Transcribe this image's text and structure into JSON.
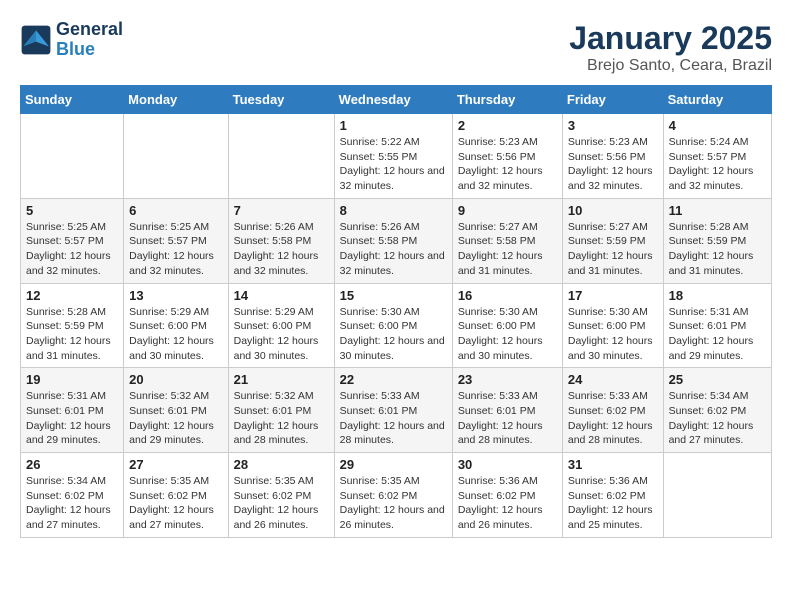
{
  "logo": {
    "line1": "General",
    "line2": "Blue"
  },
  "title": "January 2025",
  "subtitle": "Brejo Santo, Ceara, Brazil",
  "days_of_week": [
    "Sunday",
    "Monday",
    "Tuesday",
    "Wednesday",
    "Thursday",
    "Friday",
    "Saturday"
  ],
  "weeks": [
    [
      {
        "day": "",
        "info": ""
      },
      {
        "day": "",
        "info": ""
      },
      {
        "day": "",
        "info": ""
      },
      {
        "day": "1",
        "info": "Sunrise: 5:22 AM\nSunset: 5:55 PM\nDaylight: 12 hours and 32 minutes."
      },
      {
        "day": "2",
        "info": "Sunrise: 5:23 AM\nSunset: 5:56 PM\nDaylight: 12 hours and 32 minutes."
      },
      {
        "day": "3",
        "info": "Sunrise: 5:23 AM\nSunset: 5:56 PM\nDaylight: 12 hours and 32 minutes."
      },
      {
        "day": "4",
        "info": "Sunrise: 5:24 AM\nSunset: 5:57 PM\nDaylight: 12 hours and 32 minutes."
      }
    ],
    [
      {
        "day": "5",
        "info": "Sunrise: 5:25 AM\nSunset: 5:57 PM\nDaylight: 12 hours and 32 minutes."
      },
      {
        "day": "6",
        "info": "Sunrise: 5:25 AM\nSunset: 5:57 PM\nDaylight: 12 hours and 32 minutes."
      },
      {
        "day": "7",
        "info": "Sunrise: 5:26 AM\nSunset: 5:58 PM\nDaylight: 12 hours and 32 minutes."
      },
      {
        "day": "8",
        "info": "Sunrise: 5:26 AM\nSunset: 5:58 PM\nDaylight: 12 hours and 32 minutes."
      },
      {
        "day": "9",
        "info": "Sunrise: 5:27 AM\nSunset: 5:58 PM\nDaylight: 12 hours and 31 minutes."
      },
      {
        "day": "10",
        "info": "Sunrise: 5:27 AM\nSunset: 5:59 PM\nDaylight: 12 hours and 31 minutes."
      },
      {
        "day": "11",
        "info": "Sunrise: 5:28 AM\nSunset: 5:59 PM\nDaylight: 12 hours and 31 minutes."
      }
    ],
    [
      {
        "day": "12",
        "info": "Sunrise: 5:28 AM\nSunset: 5:59 PM\nDaylight: 12 hours and 31 minutes."
      },
      {
        "day": "13",
        "info": "Sunrise: 5:29 AM\nSunset: 6:00 PM\nDaylight: 12 hours and 30 minutes."
      },
      {
        "day": "14",
        "info": "Sunrise: 5:29 AM\nSunset: 6:00 PM\nDaylight: 12 hours and 30 minutes."
      },
      {
        "day": "15",
        "info": "Sunrise: 5:30 AM\nSunset: 6:00 PM\nDaylight: 12 hours and 30 minutes."
      },
      {
        "day": "16",
        "info": "Sunrise: 5:30 AM\nSunset: 6:00 PM\nDaylight: 12 hours and 30 minutes."
      },
      {
        "day": "17",
        "info": "Sunrise: 5:30 AM\nSunset: 6:00 PM\nDaylight: 12 hours and 30 minutes."
      },
      {
        "day": "18",
        "info": "Sunrise: 5:31 AM\nSunset: 6:01 PM\nDaylight: 12 hours and 29 minutes."
      }
    ],
    [
      {
        "day": "19",
        "info": "Sunrise: 5:31 AM\nSunset: 6:01 PM\nDaylight: 12 hours and 29 minutes."
      },
      {
        "day": "20",
        "info": "Sunrise: 5:32 AM\nSunset: 6:01 PM\nDaylight: 12 hours and 29 minutes."
      },
      {
        "day": "21",
        "info": "Sunrise: 5:32 AM\nSunset: 6:01 PM\nDaylight: 12 hours and 28 minutes."
      },
      {
        "day": "22",
        "info": "Sunrise: 5:33 AM\nSunset: 6:01 PM\nDaylight: 12 hours and 28 minutes."
      },
      {
        "day": "23",
        "info": "Sunrise: 5:33 AM\nSunset: 6:01 PM\nDaylight: 12 hours and 28 minutes."
      },
      {
        "day": "24",
        "info": "Sunrise: 5:33 AM\nSunset: 6:02 PM\nDaylight: 12 hours and 28 minutes."
      },
      {
        "day": "25",
        "info": "Sunrise: 5:34 AM\nSunset: 6:02 PM\nDaylight: 12 hours and 27 minutes."
      }
    ],
    [
      {
        "day": "26",
        "info": "Sunrise: 5:34 AM\nSunset: 6:02 PM\nDaylight: 12 hours and 27 minutes."
      },
      {
        "day": "27",
        "info": "Sunrise: 5:35 AM\nSunset: 6:02 PM\nDaylight: 12 hours and 27 minutes."
      },
      {
        "day": "28",
        "info": "Sunrise: 5:35 AM\nSunset: 6:02 PM\nDaylight: 12 hours and 26 minutes."
      },
      {
        "day": "29",
        "info": "Sunrise: 5:35 AM\nSunset: 6:02 PM\nDaylight: 12 hours and 26 minutes."
      },
      {
        "day": "30",
        "info": "Sunrise: 5:36 AM\nSunset: 6:02 PM\nDaylight: 12 hours and 26 minutes."
      },
      {
        "day": "31",
        "info": "Sunrise: 5:36 AM\nSunset: 6:02 PM\nDaylight: 12 hours and 25 minutes."
      },
      {
        "day": "",
        "info": ""
      }
    ]
  ]
}
